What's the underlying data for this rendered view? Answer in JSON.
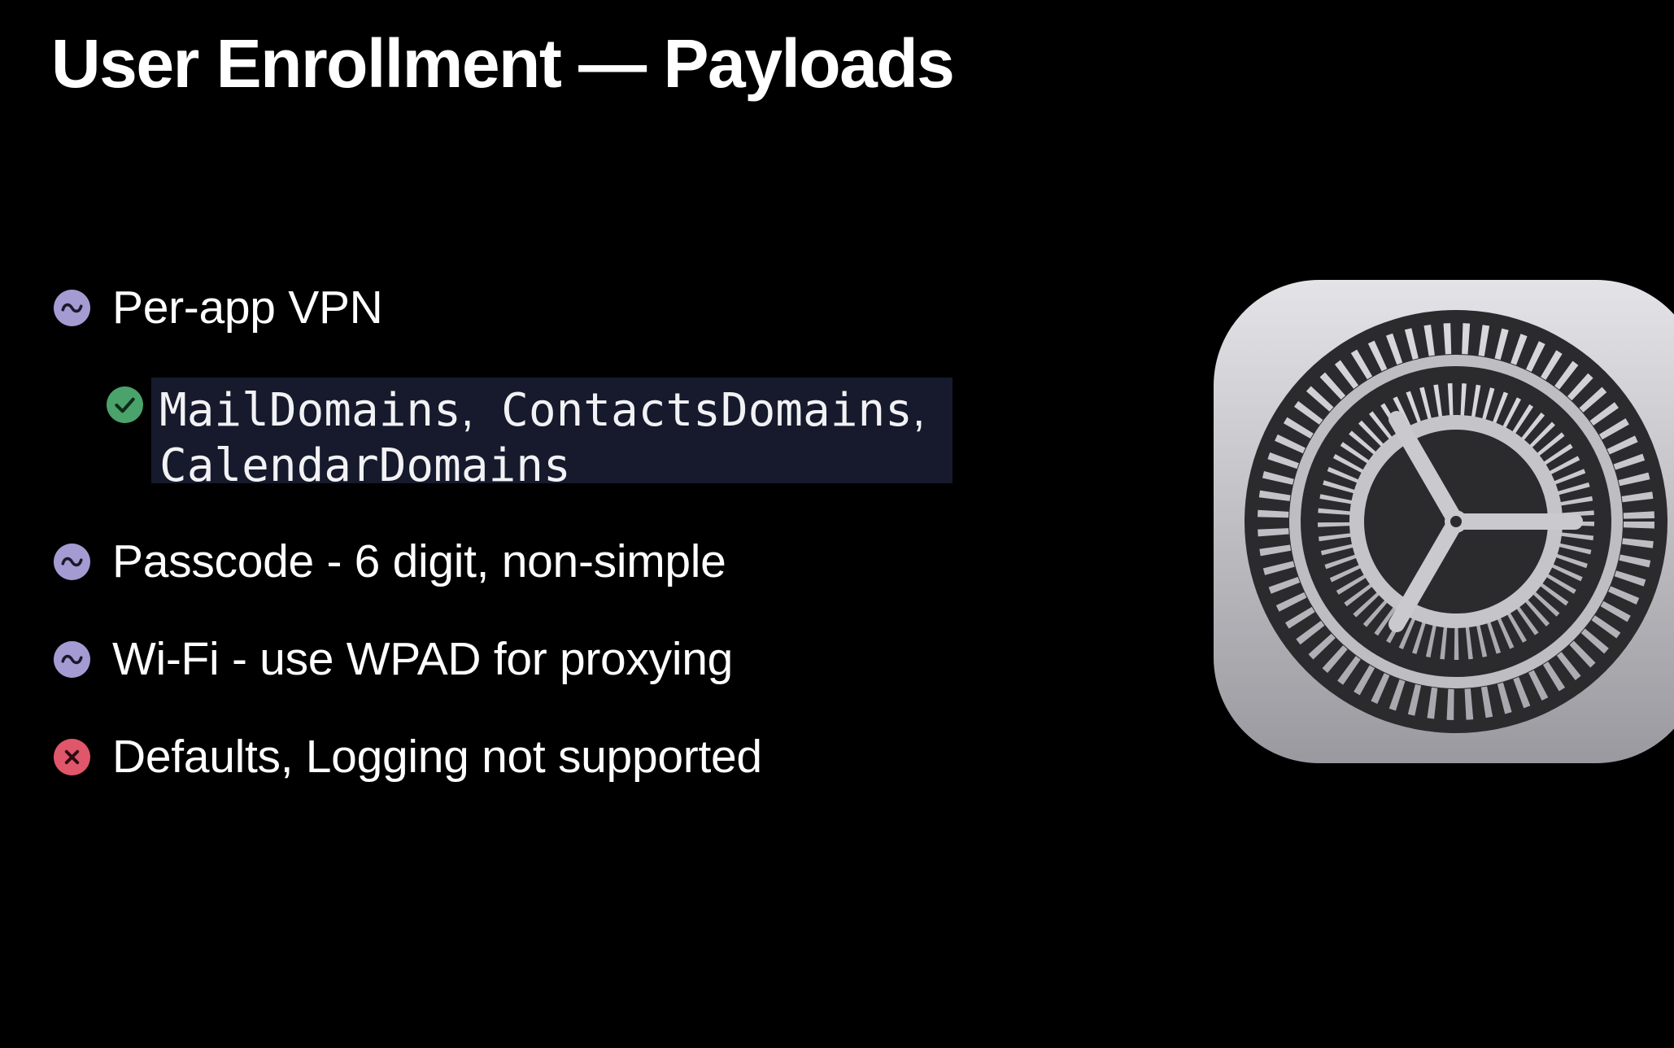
{
  "slide": {
    "title": "User Enrollment — Payloads"
  },
  "bullets": [
    {
      "status": "partial",
      "icon": "tilde-circle-icon",
      "text": "Per-app VPN"
    },
    {
      "status": "partial",
      "icon": "tilde-circle-icon",
      "text": "Passcode - 6 digit, non-simple"
    },
    {
      "status": "partial",
      "icon": "tilde-circle-icon",
      "text": "Wi-Fi - use WPAD for proxying"
    },
    {
      "status": "unsupported",
      "icon": "x-circle-icon",
      "text": "Defaults, Logging not supported"
    }
  ],
  "sub_bullet": {
    "status": "supported",
    "icon": "checkmark-circle-icon",
    "code_1": "MailDomains",
    "sep_1": ",",
    "code_2": "ContactsDomains",
    "sep_2": ",",
    "code_3": "CalendarDomains"
  },
  "side_image": {
    "icon": "settings-gear-icon"
  },
  "colors": {
    "background": "#000000",
    "text": "#ffffff",
    "partial": "#a59bd3",
    "supported": "#4aa36b",
    "unsupported": "#e0566a",
    "code_background": "#161a2c"
  }
}
